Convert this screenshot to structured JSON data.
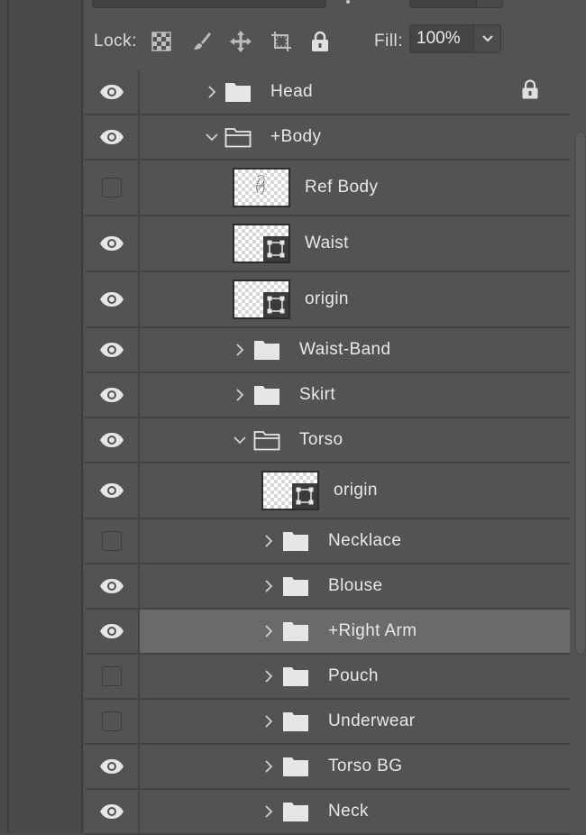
{
  "toolbar": {
    "lock_label": "Lock:",
    "lock_buttons": [
      {
        "name": "lock-transparent-pixels-icon"
      },
      {
        "name": "lock-image-pixels-brush-icon"
      },
      {
        "name": "lock-position-move-icon"
      },
      {
        "name": "lock-artboard-icon"
      },
      {
        "name": "lock-all-padlock-icon"
      }
    ],
    "fill_label": "Fill:",
    "fill_value": "100%"
  },
  "layers": [
    {
      "name": "Head",
      "type": "group",
      "expanded": false,
      "visible": true,
      "indent": 0,
      "locked": true
    },
    {
      "name": "+Body",
      "type": "group",
      "expanded": true,
      "visible": true,
      "indent": 0
    },
    {
      "name": "Ref Body",
      "type": "layer",
      "visible": false,
      "indent": 1,
      "thumb": "sketch"
    },
    {
      "name": "Waist",
      "type": "layer",
      "visible": true,
      "indent": 1,
      "thumb": "smart"
    },
    {
      "name": "origin",
      "type": "layer",
      "visible": true,
      "indent": 1,
      "thumb": "smart"
    },
    {
      "name": "Waist-Band",
      "type": "group",
      "expanded": false,
      "visible": true,
      "indent": 1
    },
    {
      "name": "Skirt",
      "type": "group",
      "expanded": false,
      "visible": true,
      "indent": 1
    },
    {
      "name": "Torso",
      "type": "group",
      "expanded": true,
      "visible": true,
      "indent": 1
    },
    {
      "name": "origin",
      "type": "layer",
      "visible": true,
      "indent": 2,
      "thumb": "smart"
    },
    {
      "name": "Necklace",
      "type": "group",
      "expanded": false,
      "visible": false,
      "indent": 2
    },
    {
      "name": "Blouse",
      "type": "group",
      "expanded": false,
      "visible": true,
      "indent": 2
    },
    {
      "name": "+Right Arm",
      "type": "group",
      "expanded": false,
      "visible": true,
      "indent": 2,
      "selected": true
    },
    {
      "name": "Pouch",
      "type": "group",
      "expanded": false,
      "visible": false,
      "indent": 2
    },
    {
      "name": "Underwear",
      "type": "group",
      "expanded": false,
      "visible": false,
      "indent": 2
    },
    {
      "name": "Torso BG",
      "type": "group",
      "expanded": false,
      "visible": true,
      "indent": 2
    },
    {
      "name": "Neck",
      "type": "group",
      "expanded": false,
      "visible": true,
      "indent": 2
    }
  ]
}
